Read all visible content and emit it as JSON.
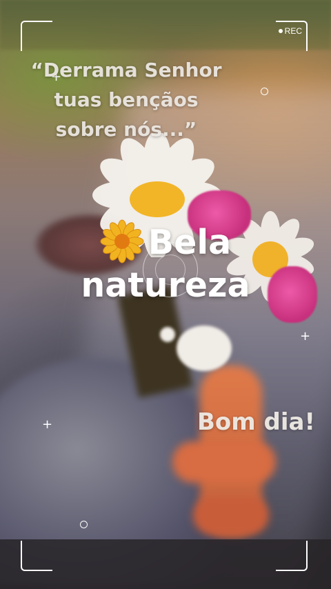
{
  "overlay": {
    "rec_label": "REC"
  },
  "content": {
    "quote_lines": [
      "“Derrama Senhor",
      "tuas bençãos",
      "sobre nós...”"
    ],
    "title_line1": "Bela",
    "title_line2": "natureza",
    "title_icon": "blossom-icon",
    "greeting": "Bom dia!"
  },
  "colors": {
    "frame": "#ffffff",
    "flower_center": "#f6c23a",
    "pink_flower": "#e0489a"
  }
}
